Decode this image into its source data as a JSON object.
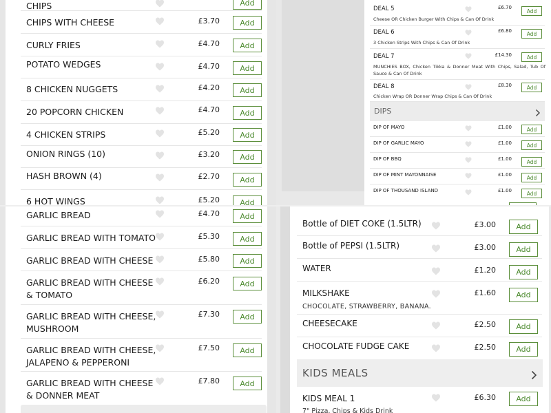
{
  "panel_tl": {
    "items": [
      {
        "name": "Chips",
        "price": "",
        "add": "Add"
      },
      {
        "name": "Chips with Cheese",
        "price": "£3.70",
        "add": "Add"
      },
      {
        "name": "Curly Fries",
        "price": "£4.70",
        "add": "Add"
      },
      {
        "name": "Potato Wedges",
        "price": "£4.70",
        "add": "Add"
      },
      {
        "name": "8 Chicken Nuggets",
        "price": "£4.20",
        "add": "Add"
      },
      {
        "name": "20 Popcorn Chicken",
        "price": "£4.70",
        "add": "Add"
      },
      {
        "name": "4 Chicken Strips",
        "price": "£5.20",
        "add": "Add"
      },
      {
        "name": "Onion Rings (10)",
        "price": "£3.20",
        "add": "Add"
      },
      {
        "name": "Hash Brown (4)",
        "price": "£2.70",
        "add": "Add"
      },
      {
        "name": "6 Hot Wings",
        "price": "£5.20",
        "add": "Add"
      }
    ]
  },
  "panel_bl": {
    "items": [
      {
        "name": "Garlic Bread",
        "price": "£4.70",
        "add": "Add"
      },
      {
        "name": "Garlic Bread with Tomato",
        "price": "£5.30",
        "add": "Add"
      },
      {
        "name": "Garlic Bread with Cheese",
        "price": "£5.80",
        "add": "Add"
      },
      {
        "name": "Garlic Bread with Cheese & Tomato",
        "price": "£6.20",
        "add": "Add"
      },
      {
        "name": "Garlic Bread with Cheese, Mushroom",
        "price": "£7.30",
        "add": "Add"
      },
      {
        "name": "Garlic Bread with Cheese, Jalapeno & Pepperoni",
        "price": "£7.50",
        "add": "Add"
      },
      {
        "name": "Garlic Bread with Cheese & Donner Meat",
        "price": "£7.80",
        "add": "Add"
      }
    ]
  },
  "panel_tr": {
    "deals": [
      {
        "name": "DEAL 5",
        "price": "£6.70",
        "desc": "Cheese OR Chicken Burger With Chips & Can Of Drink",
        "add": "Add"
      },
      {
        "name": "DEAL 6",
        "price": "£6.80",
        "desc": "3 Chicken Strips With Chips & Can Of Drink",
        "add": "Add"
      },
      {
        "name": "DEAL 7",
        "price": "£14.30",
        "desc": "MUNCHIES BOX, Chicken Tikka & Donner Meat With Chips, Salad, Tub Of Sauce & Can Of Drink",
        "add": "Add"
      },
      {
        "name": "DEAL 8",
        "price": "£8.30",
        "desc": "Chicken Wrap OR Donner Wrap Chips & Can Of Drink",
        "add": "Add"
      }
    ],
    "dips_heading": "DIPS",
    "dips": [
      {
        "name": "DIP OF MAYO",
        "price": "£1.00",
        "add": "Add"
      },
      {
        "name": "DIP OF GARLIC MAYO",
        "price": "£1.00",
        "add": "Add"
      },
      {
        "name": "DIP OF BBQ",
        "price": "£1.00",
        "add": "Add"
      },
      {
        "name": "DIP OF MINT MAYONNAISE",
        "price": "£1.00",
        "add": "Add"
      },
      {
        "name": "DIP OF THOUSAND ISLAND",
        "price": "£1.00",
        "add": "Add"
      }
    ]
  },
  "panel_br": {
    "items": [
      {
        "name": "Bottle of DIET COKE (1.5LTR)",
        "price": "£3.00",
        "add": "Add"
      },
      {
        "name": "Bottle of PEPSI (1.5LTR)",
        "price": "£3.00",
        "add": "Add"
      },
      {
        "name": "WATER",
        "price": "£1.20",
        "add": "Add"
      },
      {
        "name": "MILKSHAKE",
        "price": "£1.60",
        "desc": "CHOCOLATE, STRAWBERRY, BANANA.",
        "add": "Add"
      },
      {
        "name": "CHEESECAKE",
        "price": "£2.50",
        "add": "Add"
      },
      {
        "name": "CHOCOLATE FUDGE CAKE",
        "price": "£2.50",
        "add": "Add"
      }
    ],
    "kids_heading": "KIDS MEALS",
    "kids": [
      {
        "name": "KIDS MEAL 1",
        "price": "£6.30",
        "desc": "7\" Pizza, Chips & Kids Drink",
        "add": "Add"
      }
    ]
  },
  "colors": {
    "accent": "#4c8a2e",
    "heading_bg": "#ececec"
  }
}
